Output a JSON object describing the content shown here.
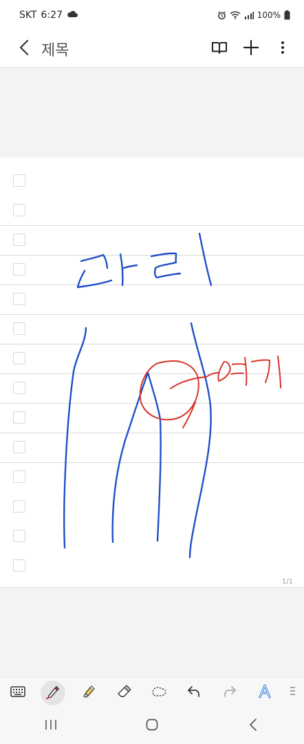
{
  "status": {
    "carrier": "SKT",
    "time": "6:27",
    "battery": "100%"
  },
  "header": {
    "title": "제목"
  },
  "page": {
    "counter": "1/1"
  },
  "handwriting": {
    "blue_word": "다리",
    "red_word": "여기"
  },
  "colors": {
    "ink_blue": "#1f4fc8",
    "ink_red": "#d9332b",
    "accent_text": "#2b7de0"
  },
  "icons": {
    "back": "chevron-left-icon",
    "reading_mode": "book-icon",
    "add": "plus-icon",
    "more": "more-vertical-icon",
    "keyboard": "keyboard-icon",
    "pen": "pen-icon",
    "highlighter": "highlighter-icon",
    "eraser": "eraser-icon",
    "lasso": "lasso-icon",
    "undo": "undo-icon",
    "redo": "redo-icon",
    "text_style": "text-style-icon"
  }
}
